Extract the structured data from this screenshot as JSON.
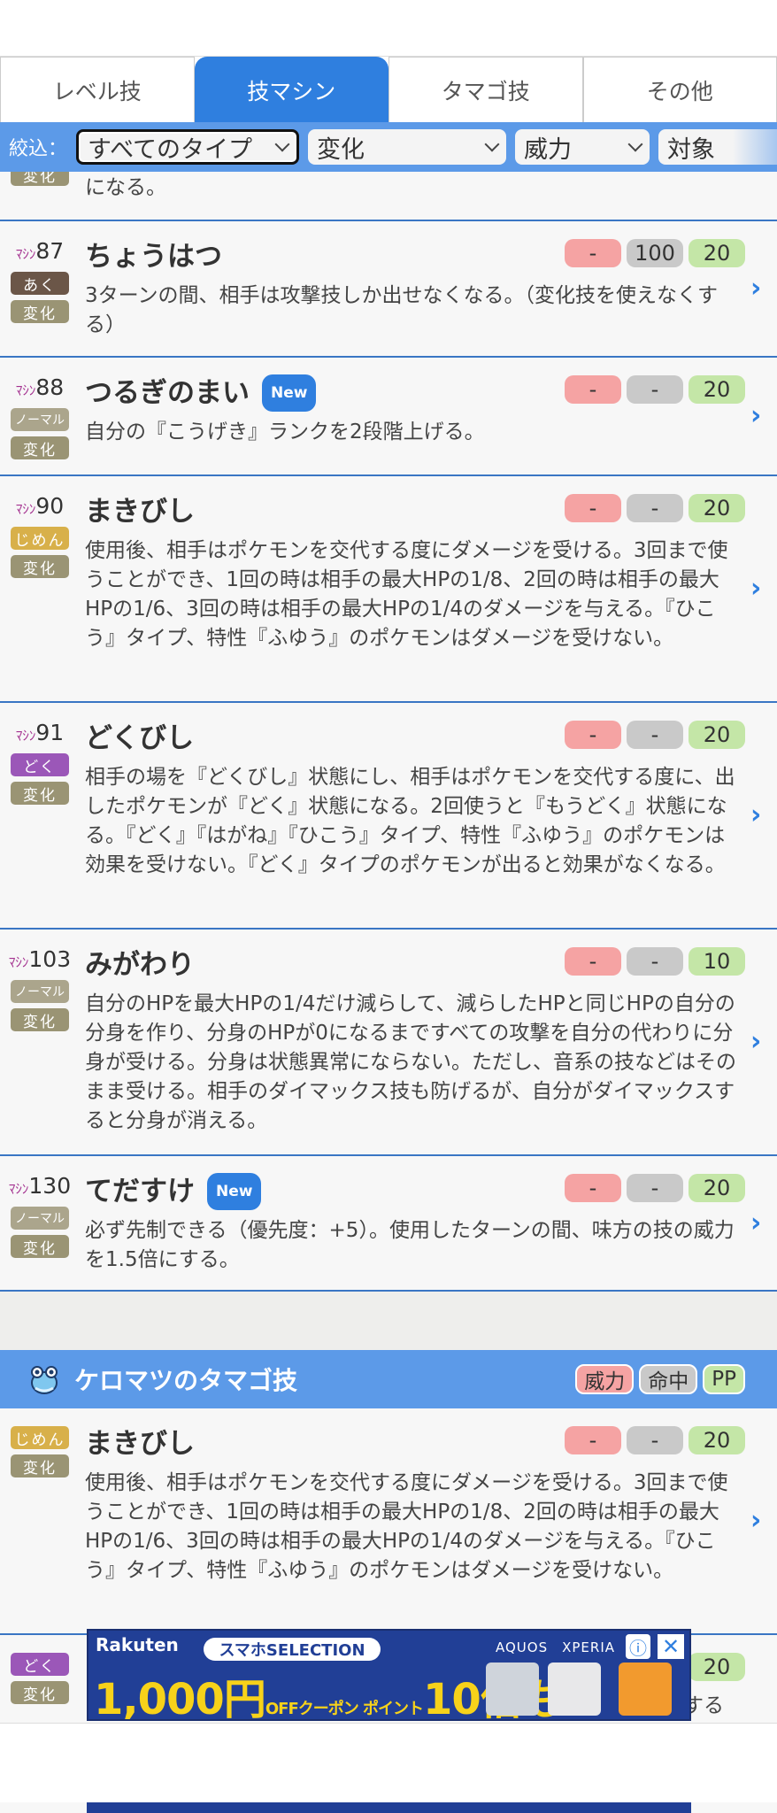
{
  "tabs": [
    "レベル技",
    "技マシン",
    "タマゴ技",
    "その他"
  ],
  "filter": {
    "label": "絞込：",
    "type": "すべてのタイプ",
    "category": "変化",
    "power": "威力",
    "target": "対象"
  },
  "partial_row": {
    "desc": "になる。",
    "category": "変化"
  },
  "tm_moves": [
    {
      "no": "87",
      "name": "ちょうはつ",
      "new": false,
      "type": "あく",
      "category": "変化",
      "power": "-",
      "accuracy": "100",
      "pp": "20",
      "desc": "3ターンの間、相手は攻撃技しか出せなくなる。（変化技を使えなくする）"
    },
    {
      "no": "88",
      "name": "つるぎのまい",
      "new": true,
      "type": "ノーマル",
      "category": "変化",
      "power": "-",
      "accuracy": "-",
      "pp": "20",
      "desc": "自分の『こうげき』ランクを2段階上げる。"
    },
    {
      "no": "90",
      "name": "まきびし",
      "new": false,
      "type": "じめん",
      "category": "変化",
      "power": "-",
      "accuracy": "-",
      "pp": "20",
      "desc": "使用後、相手はポケモンを交代する度にダメージを受ける。3回まで使うことができ、1回の時は相手の最大HPの1/8、2回の時は相手の最大HPの1/6、3回の時は相手の最大HPの1/4のダメージを与える。『ひこう』タイプ、特性『ふゆう』のポケモンはダメージを受けない。"
    },
    {
      "no": "91",
      "name": "どくびし",
      "new": false,
      "type": "どく",
      "category": "変化",
      "power": "-",
      "accuracy": "-",
      "pp": "20",
      "desc": "相手の場を『どくびし』状態にし、相手はポケモンを交代する度に、出したポケモンが『どく』状態になる。2回使うと『もうどく』状態になる。『どく』『はがね』『ひこう』タイプ、特性『ふゆう』のポケモンは効果を受けない。『どく』タイプのポケモンが出ると効果がなくなる。"
    },
    {
      "no": "103",
      "name": "みがわり",
      "new": false,
      "type": "ノーマル",
      "category": "変化",
      "power": "-",
      "accuracy": "-",
      "pp": "10",
      "desc": "自分のHPを最大HPの1/4だけ減らして、減らしたHPと同じHPの自分の分身を作り、分身のHPが0になるまですべての攻撃を自分の代わりに分身が受ける。分身は状態異常にならない。ただし、音系の技などはそのまま受ける。相手のダイマックス技も防げるが、自分がダイマックスすると分身が消える。"
    },
    {
      "no": "130",
      "name": "てだすけ",
      "new": true,
      "type": "ノーマル",
      "category": "変化",
      "power": "-",
      "accuracy": "-",
      "pp": "20",
      "desc": "必ず先制できる（優先度：+5）。使用したターンの間、味方の技の威力を1.5倍にする。"
    }
  ],
  "tm_prefix": "ﾏｼﾝ",
  "new_label": "New",
  "section": {
    "title": "ケロマツのタマゴ技",
    "headers": {
      "power": "威力",
      "accuracy": "命中",
      "pp": "PP"
    }
  },
  "egg_moves": [
    {
      "name": "まきびし",
      "type": "じめん",
      "category": "変化",
      "power": "-",
      "accuracy": "-",
      "pp": "20",
      "desc": "使用後、相手はポケモンを交代する度にダメージを受ける。3回まで使うことができ、1回の時は相手の最大HPの1/8、2回の時は相手の最大HPの1/6、3回の時は相手の最大HPの1/4のダメージを与える。『ひこう』タイプ、特性『ふゆう』のポケモンはダメージを受けない。"
    },
    {
      "name": "",
      "type": "どく",
      "category": "変化",
      "power": "",
      "accuracy": "",
      "pp": "20",
      "desc": "する"
    }
  ],
  "ad": {
    "brand": "Rakuten",
    "selection": "スマホSELECTION",
    "brands": "AQUOS　XPERIA",
    "main": "1,000円",
    "main_small": "OFFクーポン ポイント",
    "main2": "10倍も!",
    "info": "ⓘ",
    "close": "✕"
  },
  "colors": {
    "accent": "#2f7fdf",
    "filter_bar": "#5c9ae8",
    "row_border": "#3a76c4",
    "type_dark": "#6b5648",
    "type_normal": "#aba58c",
    "type_ground": "#d8b04a",
    "type_poison": "#9b57b8",
    "category": "#9a9474",
    "power_bg": "#f5a3a3",
    "accuracy_bg": "#c9c9c9",
    "pp_bg": "#c4e6a7"
  }
}
